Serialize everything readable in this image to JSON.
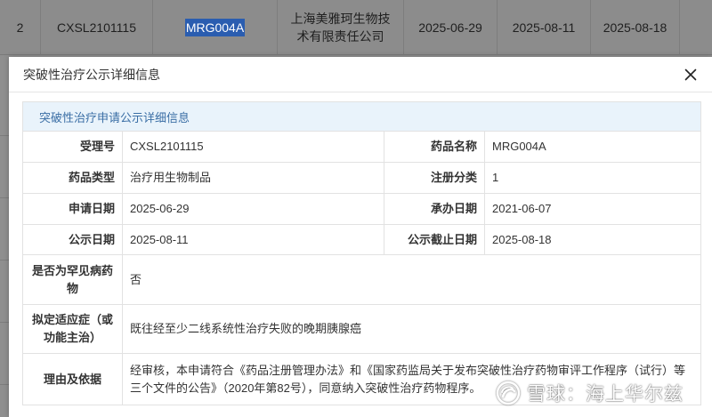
{
  "background_row": {
    "index": "2",
    "acceptance_no": "CXSL2101115",
    "drug_name": "MRG004A",
    "company": "上海美雅珂生物技术有限责任公司",
    "date1": "2025-06-29",
    "date2": "2025-08-11",
    "date3": "2025-08-18"
  },
  "modal": {
    "title": "突破性治疗公示详细信息",
    "section_title": "突破性治疗申请公示详细信息",
    "rows": [
      {
        "l1": "受理号",
        "v1": "CXSL2101115",
        "l2": "药品名称",
        "v2": "MRG004A"
      },
      {
        "l1": "药品类型",
        "v1": "治疗用生物制品",
        "l2": "注册分类",
        "v2": "1"
      },
      {
        "l1": "申请日期",
        "v1": "2025-06-29",
        "l2": "承办日期",
        "v2": "2021-06-07"
      },
      {
        "l1": "公示日期",
        "v1": "2025-08-11",
        "l2": "公示截止日期",
        "v2": "2025-08-18"
      }
    ],
    "rare_disease": {
      "label": "是否为罕见病药物",
      "value": "否"
    },
    "indication": {
      "label": "拟定适应症（或功能主治）",
      "value": "既往经至少二线系统性治疗失败的晚期胰腺癌"
    },
    "reason": {
      "label": "理由及依据",
      "value": "经审核，本申请符合《药品注册管理办法》和《国家药监局关于发布突破性治疗药物审评工作程序（试行）等三个文件的公告》（2020年第82号），同意纳入突破性治疗药物程序。"
    }
  },
  "watermark": {
    "text": "雪球：海上华尔兹",
    "icon": "snowball-logo-icon"
  }
}
